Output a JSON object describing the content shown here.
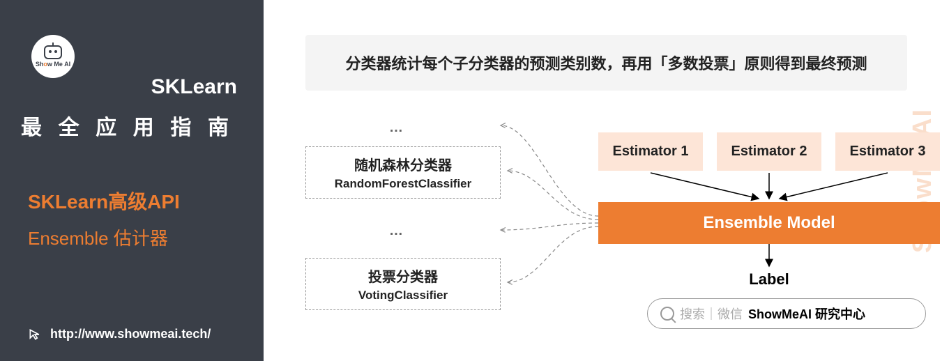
{
  "sidebar": {
    "logo_text": "ShowMeAI",
    "title": "SKLearn",
    "subtitle": "最全应用指南",
    "api_line": "SKLearn高级API",
    "ensemble_line": "Ensemble 估计器",
    "url": "http://www.showmeai.tech/"
  },
  "content": {
    "headline": "分类器统计每个子分类器的预测类别数，再用「多数投票」原则得到最终预测",
    "watermark": "ShowMeAI",
    "dots": "…",
    "box1": {
      "title": "随机森林分类器",
      "sub": "RandomForestClassifier"
    },
    "box2": {
      "title": "投票分类器",
      "sub": "VotingClassifier"
    },
    "estimators": [
      "Estimator 1",
      "Estimator 2",
      "Estimator 3"
    ],
    "ensemble": "Ensemble Model",
    "label": "Label",
    "search": {
      "gray": "搜索｜微信",
      "bold": "ShowMeAI 研究中心"
    }
  }
}
